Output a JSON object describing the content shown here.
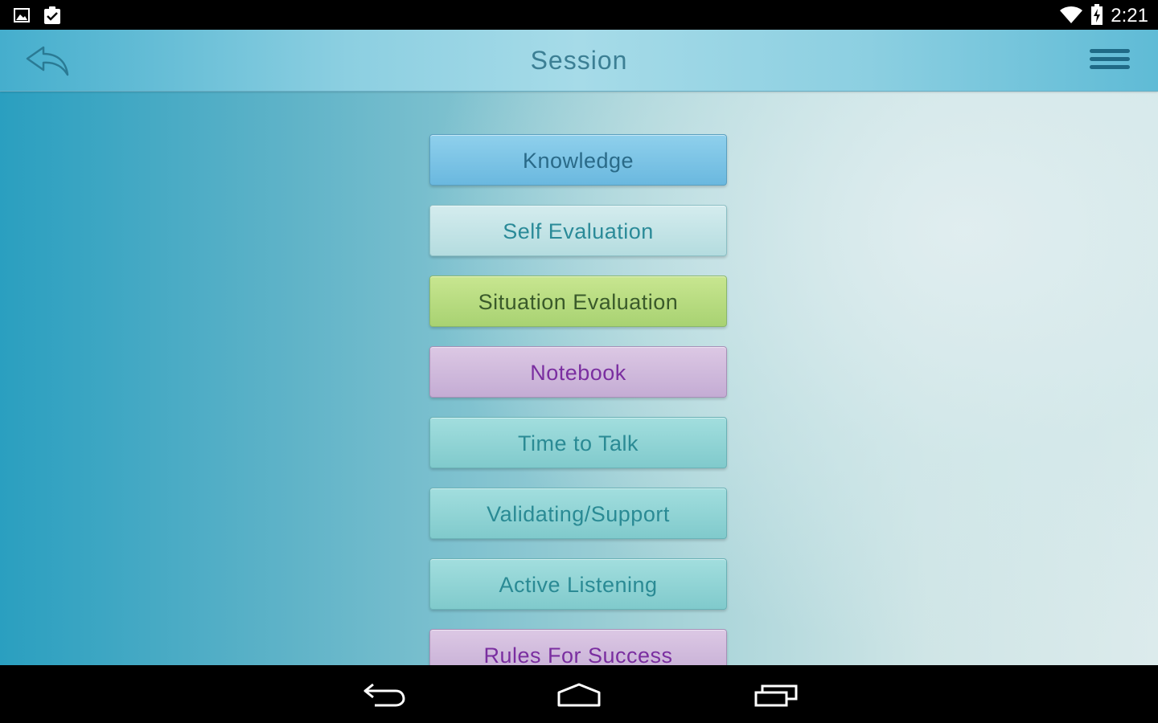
{
  "status_bar": {
    "time": "2:21",
    "icons": [
      "picture-icon",
      "clipboard-check-icon",
      "wifi-icon",
      "battery-charging-icon"
    ]
  },
  "header": {
    "title": "Session",
    "back_icon": "reply-arrow-icon",
    "menu_icon": "hamburger-menu-icon",
    "accent_color": "#3c7f94"
  },
  "menu": {
    "items": [
      {
        "label": "Knowledge",
        "color": "#7ec4e6"
      },
      {
        "label": "Self Evaluation",
        "color": "#c4e4e6"
      },
      {
        "label": "Situation Evaluation",
        "color": "#b8dc80"
      },
      {
        "label": "Notebook",
        "color": "#d0badc"
      },
      {
        "label": "Time to Talk",
        "color": "#90d4d6"
      },
      {
        "label": "Validating/Support",
        "color": "#90d4d6"
      },
      {
        "label": "Active Listening",
        "color": "#90d4d6"
      },
      {
        "label": "Rules For Success",
        "color": "#d0badc"
      }
    ]
  },
  "nav_bar": {
    "icons": [
      "back-icon",
      "home-icon",
      "recent-apps-icon"
    ]
  }
}
